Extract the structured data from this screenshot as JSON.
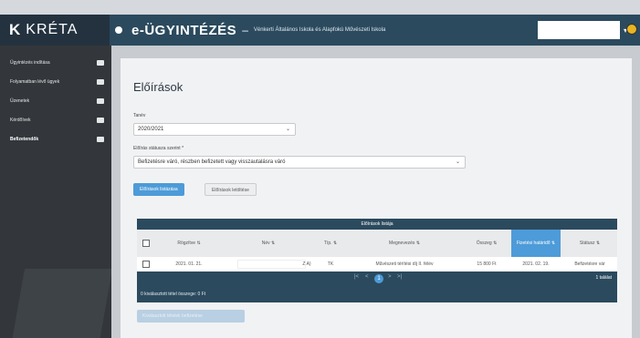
{
  "header": {
    "logo": "K",
    "brand": "KRÉTA",
    "app_title": "e-ÜGYINTÉZÉS",
    "separator": "–",
    "school": "Vénkerti Általános Iskola és Alapfokú Művészeti Iskola"
  },
  "sidebar": {
    "items": [
      {
        "label": "Ügyintézés indítása",
        "icon": "edit-icon"
      },
      {
        "label": "Folyamatban lévő ügyek",
        "icon": "folder-icon"
      },
      {
        "label": "Üzenetek",
        "icon": "mail-icon"
      },
      {
        "label": "Kérdőívek",
        "icon": "list-icon"
      },
      {
        "label": "Befizetendők",
        "icon": "bank-icon",
        "active": true
      }
    ]
  },
  "main": {
    "title": "Előírások",
    "tanev_label": "Tanév",
    "tanev_value": "2020/2021",
    "status_label": "Előírás státusza szerint *",
    "status_value": "Befizetésre váró, részben befizetett vagy visszautalásra váró",
    "btn_list": "Előírások listázása",
    "btn_download": "Előírások letöltése"
  },
  "table": {
    "caption": "Előírások listája",
    "columns": [
      "Rögzítve ⇅",
      "Név ⇅",
      "Típ. ⇅",
      "Megnevezés ⇅",
      "Összeg ⇅",
      "Fizetési határidő ⇅",
      "Státusz ⇅"
    ],
    "rows": [
      {
        "date": "2021. 01. 21.",
        "name_suffix": "Z A)",
        "type": "TK",
        "desc": "Művészeti térítési díj II. félév",
        "amount": "15 800 Ft",
        "due": "2021. 02. 19.",
        "status": "Befizetésre vár"
      }
    ],
    "pager": {
      "first": "|<",
      "prev": "<",
      "page": "1",
      "next": ">",
      "last": ">|"
    },
    "count": "1 találat",
    "footer": "0 kiválasztott tétel összege: 0 Ft",
    "pay_button": "Kiválasztott tételek befizetése"
  }
}
